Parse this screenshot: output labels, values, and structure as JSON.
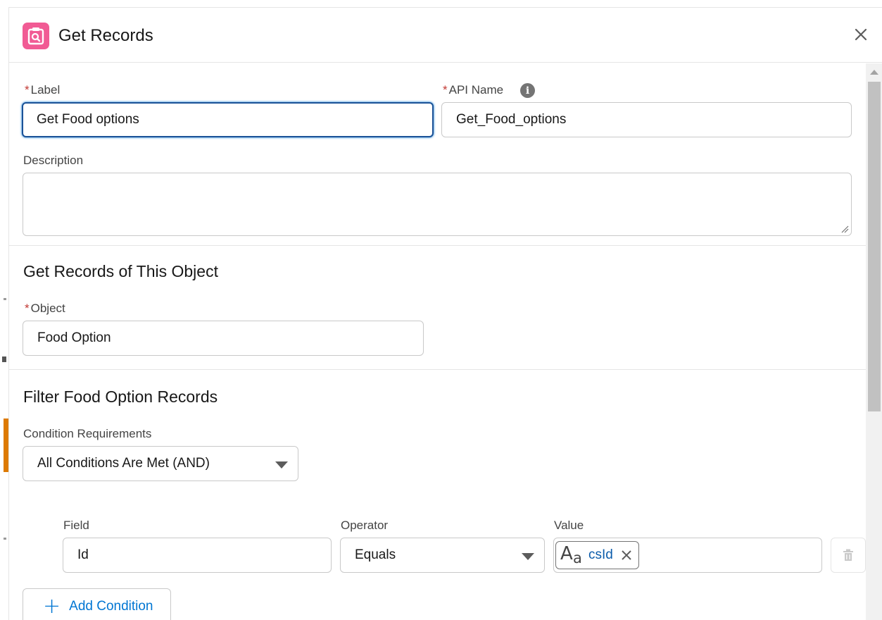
{
  "header": {
    "title": "Get Records",
    "icon": "get-records-icon",
    "icon_color": "#f15b94"
  },
  "form": {
    "required_marker": "*",
    "label": {
      "caption": "Label",
      "value": "Get Food options"
    },
    "api_name": {
      "caption": "API Name",
      "value": "Get_Food_options",
      "info_glyph": "i"
    },
    "description": {
      "caption": "Description",
      "value": ""
    }
  },
  "object_section": {
    "title": "Get Records of This Object",
    "object": {
      "caption": "Object",
      "value": "Food Option"
    }
  },
  "filter_section": {
    "title": "Filter Food Option Records",
    "condition_requirements": {
      "caption": "Condition Requirements",
      "selected": "All Conditions Are Met (AND)"
    },
    "conditions": [
      {
        "field_caption": "Field",
        "field_value": "Id",
        "operator_caption": "Operator",
        "operator_value": "Equals",
        "value_caption": "Value",
        "value_type_big": "A",
        "value_type_small": "a",
        "value_text": "csId"
      }
    ],
    "add_condition_label": "Add Condition",
    "add_condition_glyph": "+"
  },
  "colors": {
    "accent": "#0176d3",
    "focus_border": "#1b5297",
    "required": "#c23934",
    "background_accent": "#dd7a01"
  }
}
